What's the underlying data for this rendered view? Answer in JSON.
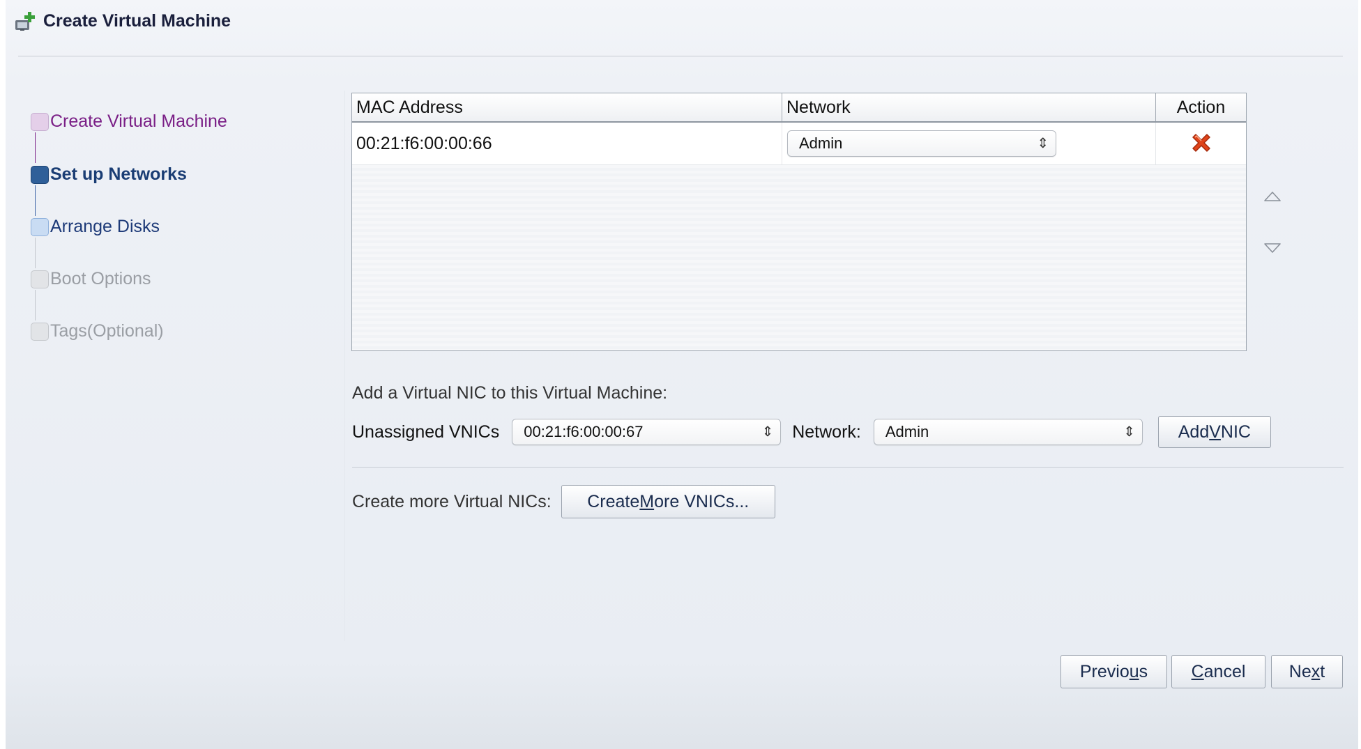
{
  "dialog": {
    "title": "Create Virtual Machine"
  },
  "train": {
    "steps": [
      {
        "label": "Create Virtual Machine",
        "state": "visited"
      },
      {
        "label": "Set up Networks",
        "state": "current"
      },
      {
        "label": "Arrange Disks",
        "state": "next"
      },
      {
        "label": "Boot Options",
        "state": "disabled"
      },
      {
        "label": "Tags(Optional)",
        "state": "disabled"
      }
    ]
  },
  "table": {
    "headers": {
      "mac": "MAC Address",
      "network": "Network",
      "action": "Action"
    },
    "rows": [
      {
        "mac": "00:21:f6:00:00:66",
        "network": "Admin",
        "action_icon": "delete-icon"
      }
    ]
  },
  "reorder": {
    "up_icon": "move-up-icon",
    "down_icon": "move-down-icon"
  },
  "add_vnic": {
    "heading": "Add a Virtual NIC to this Virtual Machine:",
    "unassigned_label": "Unassigned VNICs",
    "unassigned_value": "00:21:f6:00:00:67",
    "network_label": "Network:",
    "network_value": "Admin",
    "button_label": "Add VNIC",
    "button_mnemonic": "V"
  },
  "create_more": {
    "label": "Create more Virtual NICs:",
    "button_label": "Create More VNICs...",
    "button_mnemonic": "M"
  },
  "buttons": {
    "previous": "Previous",
    "previous_mnemonic": "u",
    "cancel": "Cancel",
    "cancel_mnemonic": "C",
    "next": "Next",
    "next_mnemonic": "x"
  },
  "colors": {
    "accent": "#1a3d74",
    "visited": "#7a1f86",
    "disabled": "#9a9ea4",
    "delete": "#e0441a"
  }
}
